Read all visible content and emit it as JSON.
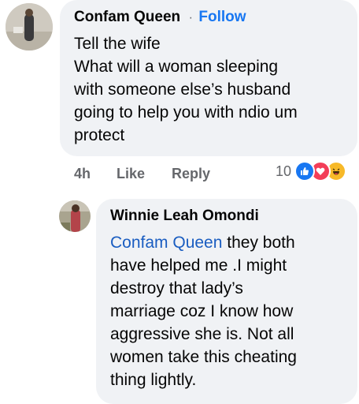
{
  "comment": {
    "author": "Confam Queen",
    "separator": "·",
    "follow_label": "Follow",
    "lines": [
      "Tell the wife",
      "What will a woman sleeping",
      "with someone else’s husband",
      "going to help you with ndio um",
      "protect"
    ],
    "time": "4h",
    "like_label": "Like",
    "reply_label": "Reply",
    "reaction_count": "10",
    "reaction_icons": [
      "like-icon",
      "love-icon",
      "haha-icon"
    ]
  },
  "reply": {
    "author": "Winnie Leah Omondi",
    "mention": "Confam Queen",
    "first_line_rest": " they both",
    "lines": [
      "have helped me .I might",
      "destroy that lady’s",
      "marriage coz I know how",
      "aggressive she is. Not all",
      "women take this cheating",
      "thing lightly."
    ]
  },
  "colors": {
    "bubble": "#f0f2f5",
    "link": "#1877f2",
    "mention": "#1a5dc1",
    "meta": "#65676b",
    "like_blue": "#1877f2",
    "love_red": "#f33e58",
    "haha_yellow": "#f7b928"
  }
}
